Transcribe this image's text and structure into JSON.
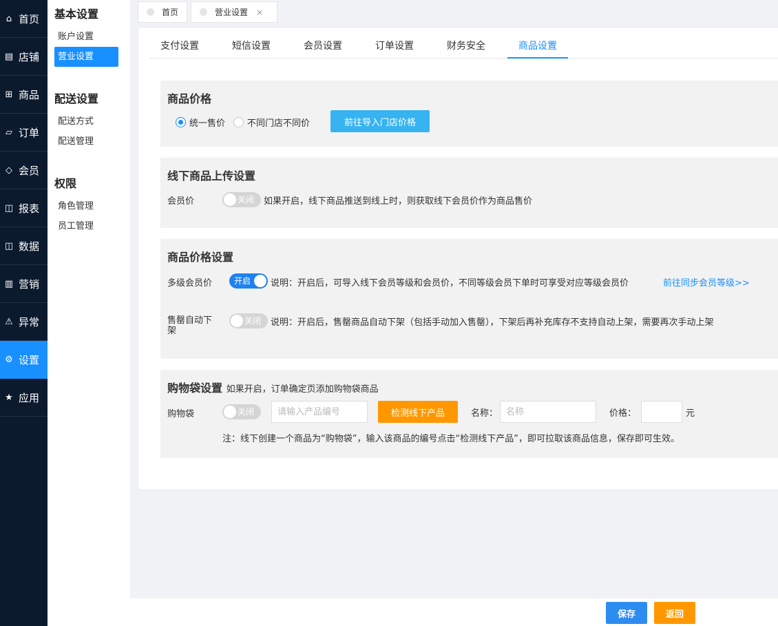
{
  "nav": {
    "items": [
      {
        "label": "首页",
        "icon": "home-icon",
        "glyph": "⌂"
      },
      {
        "label": "店铺",
        "icon": "store-icon",
        "glyph": "▤"
      },
      {
        "label": "商品",
        "icon": "gift-icon",
        "glyph": "⊞"
      },
      {
        "label": "订单",
        "icon": "order-icon",
        "glyph": "▱"
      },
      {
        "label": "会员",
        "icon": "diamond-icon",
        "glyph": "◇"
      },
      {
        "label": "报表",
        "icon": "report-icon",
        "glyph": "◫"
      },
      {
        "label": "数据",
        "icon": "data-icon",
        "glyph": "◫"
      },
      {
        "label": "营销",
        "icon": "bar-chart-icon",
        "glyph": "▥"
      },
      {
        "label": "异常",
        "icon": "warning-icon",
        "glyph": "⚠"
      },
      {
        "label": "设置",
        "icon": "gear-icon",
        "glyph": "⚙"
      },
      {
        "label": "应用",
        "icon": "star-icon",
        "glyph": "★"
      }
    ],
    "active_index": 9
  },
  "subnav": {
    "groups": [
      {
        "title": "基本设置",
        "items": [
          "账户设置",
          "营业设置"
        ]
      },
      {
        "title": "配送设置",
        "items": [
          "配送方式",
          "配送管理"
        ]
      },
      {
        "title": "权限",
        "items": [
          "角色管理",
          "员工管理"
        ]
      }
    ],
    "active": "营业设置"
  },
  "page_tabs": [
    {
      "label": "首页",
      "closable": false
    },
    {
      "label": "营业设置",
      "closable": true
    }
  ],
  "close_glyph": "×",
  "settings_tabs": [
    "支付设置",
    "短信设置",
    "会员设置",
    "订单设置",
    "财务安全",
    "商品设置"
  ],
  "settings_tab_active": "商品设置",
  "price_section": {
    "title": "商品价格",
    "option_unified": "统一售价",
    "option_per_store": "不同门店不同价",
    "selected": "统一售价",
    "import_button": "前往导入门店价格"
  },
  "offline_upload": {
    "title": "线下商品上传设置",
    "member_price_label": "会员价",
    "switch_text": "关闭",
    "switch_on": false,
    "description": "如果开启，线下商品推送到线上时，则获取线下会员价作为商品售价"
  },
  "price_settings": {
    "title": "商品价格设置",
    "multi_level_label": "多级会员价",
    "multi_level_switch_text": "开启",
    "multi_level_on": true,
    "multi_level_desc": "说明：开启后，可导入线下会员等级和会员价，不同等级会员下单时可享受对应等级会员价",
    "sync_link": "前往同步会员等级>>",
    "soldout_label_line1": "售罄自动下",
    "soldout_label_line2": "架",
    "soldout_switch_text": "关闭",
    "soldout_on": false,
    "soldout_desc": "说明：开启后，售罄商品自动下架（包括手动加入售罄），下架后再补充库存不支持自动上架，需要再次手动上架"
  },
  "bag": {
    "title": "购物袋设置",
    "title_note": "如果开启，订单确定页添加购物袋商品",
    "label": "购物袋",
    "switch_text": "关闭",
    "switch_on": false,
    "code_placeholder": "请输入产品编号",
    "detect_button": "检测线下产品",
    "name_label": "名称：",
    "name_placeholder": "名称",
    "price_label": "价格：",
    "price_value": "",
    "unit": "元",
    "note": "注：线下创建一个商品为“购物袋”，输入该商品的编号点击“检测线下产品”，即可拉取该商品信息，保存即可生效。"
  },
  "footer": {
    "save": "保存",
    "back": "返回"
  }
}
